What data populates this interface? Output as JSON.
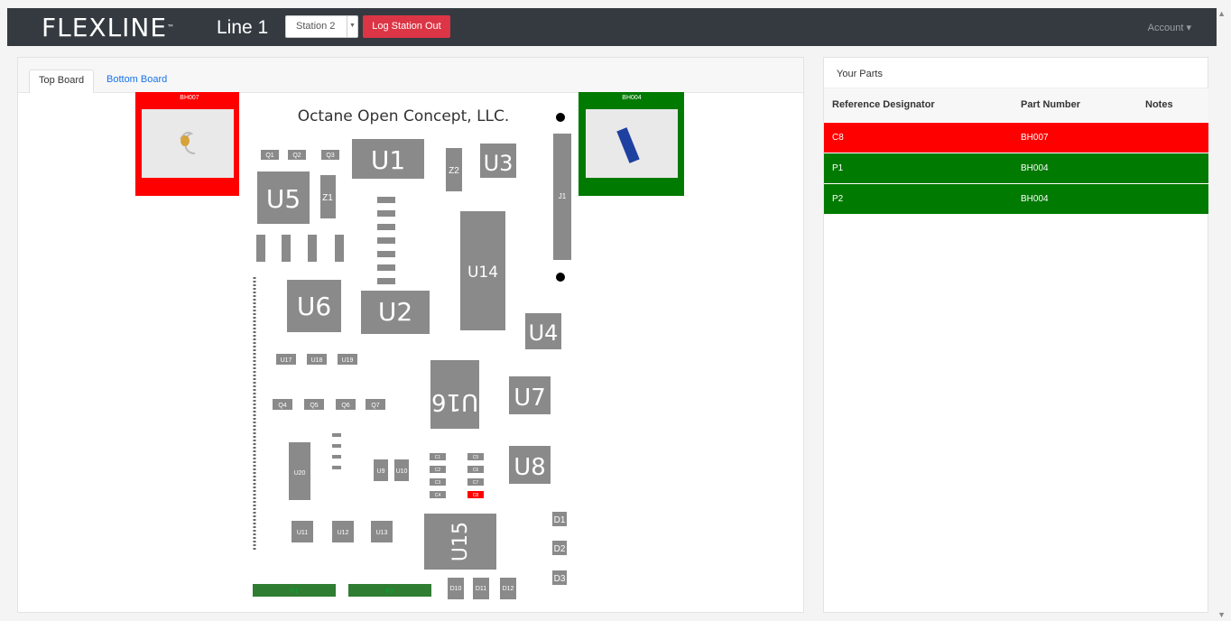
{
  "header": {
    "brand": "FLEXLINE",
    "brand_tm": "™",
    "line_title": "Line 1",
    "station_selected": "Station 2",
    "logout_label": "Log Station Out",
    "account_label": "Account ▾"
  },
  "tabs": [
    {
      "label": "Top Board",
      "active": true
    },
    {
      "label": "Bottom Board",
      "active": false
    }
  ],
  "board": {
    "company_label": "Octane Open Concept, LLC.",
    "callouts": [
      {
        "label": "BH007",
        "status": "red"
      },
      {
        "label": "BH004",
        "status": "green"
      }
    ],
    "components": {
      "big": [
        "U1",
        "U2",
        "U3",
        "U4",
        "U5",
        "U6",
        "U7",
        "U8",
        "U14",
        "U15",
        "U16"
      ],
      "small": [
        "Q1",
        "Q2",
        "Q3",
        "Q4",
        "Q5",
        "Q6",
        "Q7",
        "Z1",
        "Z2",
        "J1",
        "U9",
        "U10",
        "U11",
        "U12",
        "U13",
        "U17",
        "U18",
        "U19",
        "U20",
        "D1",
        "D2",
        "D3",
        "D10",
        "D11",
        "D12",
        "C1",
        "C2",
        "C3",
        "C4",
        "C5",
        "C6",
        "C7",
        "C8",
        "P1",
        "P2"
      ]
    }
  },
  "parts": {
    "title": "Your Parts",
    "columns": [
      "Reference Designator",
      "Part Number",
      "Notes"
    ],
    "rows": [
      {
        "ref": "C8",
        "part": "BH007",
        "notes": "",
        "status": "red"
      },
      {
        "ref": "P1",
        "part": "BH004",
        "notes": "",
        "status": "green"
      },
      {
        "ref": "P2",
        "part": "BH004",
        "notes": "",
        "status": "green"
      }
    ]
  },
  "colors": {
    "navbar": "#343a40",
    "danger": "#dc3545",
    "callout_red": "#ff0000",
    "callout_green": "#007a00",
    "chip": "#8a8a8a",
    "connector": "#2e7d32"
  }
}
